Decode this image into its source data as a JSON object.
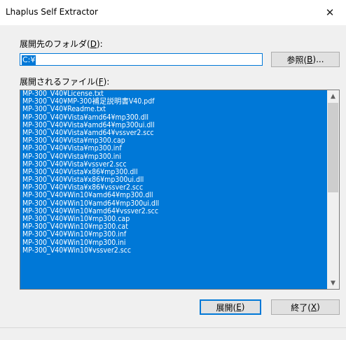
{
  "window": {
    "title": "Lhaplus Self Extractor",
    "close_glyph": "✕"
  },
  "folder": {
    "label_pre": "展開先のフォルダ(",
    "label_key": "D",
    "label_post": "):",
    "value": "C:¥",
    "browse_button": {
      "pre": "参照(",
      "key": "B",
      "post": ")..."
    }
  },
  "files": {
    "label_pre": "展開されるファイル(",
    "label_key": "F",
    "label_post": "):",
    "items": [
      "MP-300_V40¥License.txt",
      "MP-300_V40¥MP-300補足説明書V40.pdf",
      "MP-300_V40¥Readme.txt",
      "MP-300_V40¥Vista¥amd64¥mp300.dll",
      "MP-300_V40¥Vista¥amd64¥mp300ui.dll",
      "MP-300_V40¥Vista¥amd64¥vssver2.scc",
      "MP-300_V40¥Vista¥mp300.cap",
      "MP-300_V40¥Vista¥mp300.inf",
      "MP-300_V40¥Vista¥mp300.ini",
      "MP-300_V40¥Vista¥vssver2.scc",
      "MP-300_V40¥Vista¥x86¥mp300.dll",
      "MP-300_V40¥Vista¥x86¥mp300ui.dll",
      "MP-300_V40¥Vista¥x86¥vssver2.scc",
      "MP-300_V40¥Win10¥amd64¥mp300.dll",
      "MP-300_V40¥Win10¥amd64¥mp300ui.dll",
      "MP-300_V40¥Win10¥amd64¥vssver2.scc",
      "MP-300_V40¥Win10¥mp300.cap",
      "MP-300_V40¥Win10¥mp300.cat",
      "MP-300_V40¥Win10¥mp300.inf",
      "MP-300_V40¥Win10¥mp300.ini",
      "MP-300_V40¥Win10¥vssver2.scc"
    ]
  },
  "buttons": {
    "extract": {
      "pre": "展開(",
      "key": "E",
      "post": ")"
    },
    "exit": {
      "pre": "終了(",
      "key": "X",
      "post": ")"
    }
  },
  "colors": {
    "selection": "#0078d7",
    "client_bg": "#f0f0f0"
  },
  "icons": {
    "scroll_up": "▲",
    "scroll_down": "▼"
  }
}
